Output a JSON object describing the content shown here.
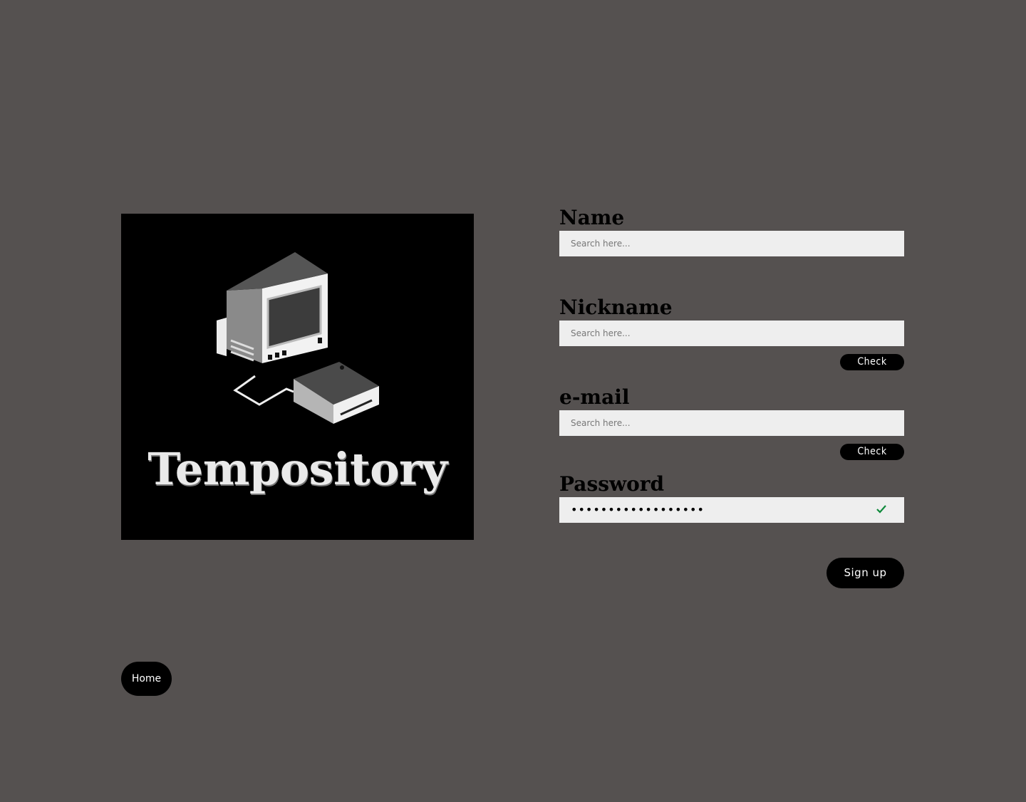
{
  "brand": {
    "name": "Tempository"
  },
  "form": {
    "name": {
      "label": "Name",
      "placeholder": "Search here..."
    },
    "nickname": {
      "label": "Nickname",
      "placeholder": "Search here...",
      "check_label": "Check"
    },
    "email": {
      "label": "e-mail",
      "placeholder": "Search here...",
      "check_label": "Check"
    },
    "password": {
      "label": "Password",
      "value_masked": "••••••••••••••••••",
      "valid": true
    },
    "signup_label": "Sign up"
  },
  "nav": {
    "home_label": "Home"
  },
  "colors": {
    "background": "#555150",
    "button": "#000000",
    "input": "#eeeeee",
    "valid_check": "#0f8a3c"
  }
}
